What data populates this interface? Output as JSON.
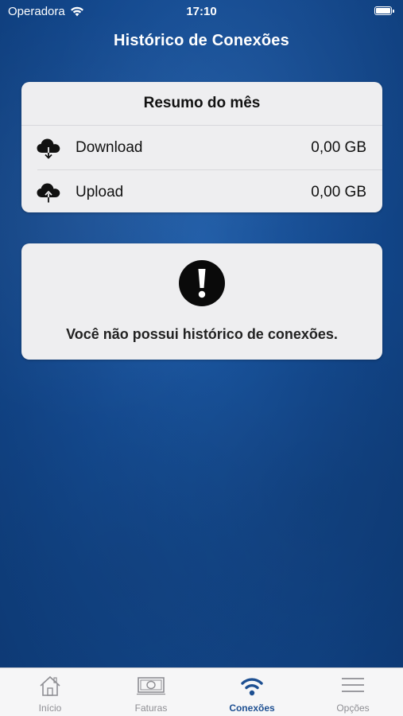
{
  "status_bar": {
    "carrier": "Operadora",
    "time": "17:10"
  },
  "nav": {
    "title": "Histórico de Conexões"
  },
  "summary": {
    "title": "Resumo do mês",
    "rows": [
      {
        "label": "Download",
        "value": "0,00 GB",
        "icon": "cloud-download-icon"
      },
      {
        "label": "Upload",
        "value": "0,00 GB",
        "icon": "cloud-upload-icon"
      }
    ]
  },
  "empty_state": {
    "icon": "exclamation-icon",
    "message": "Você não possui histórico de conexões."
  },
  "tabs": [
    {
      "label": "Início",
      "icon": "home-icon",
      "active": false
    },
    {
      "label": "Faturas",
      "icon": "money-icon",
      "active": false
    },
    {
      "label": "Conexões",
      "icon": "wifi-icon",
      "active": true
    },
    {
      "label": "Opções",
      "icon": "menu-icon",
      "active": false
    }
  ],
  "colors": {
    "accent": "#1d4f91",
    "background": "#144a90",
    "card": "#eeeef0"
  }
}
